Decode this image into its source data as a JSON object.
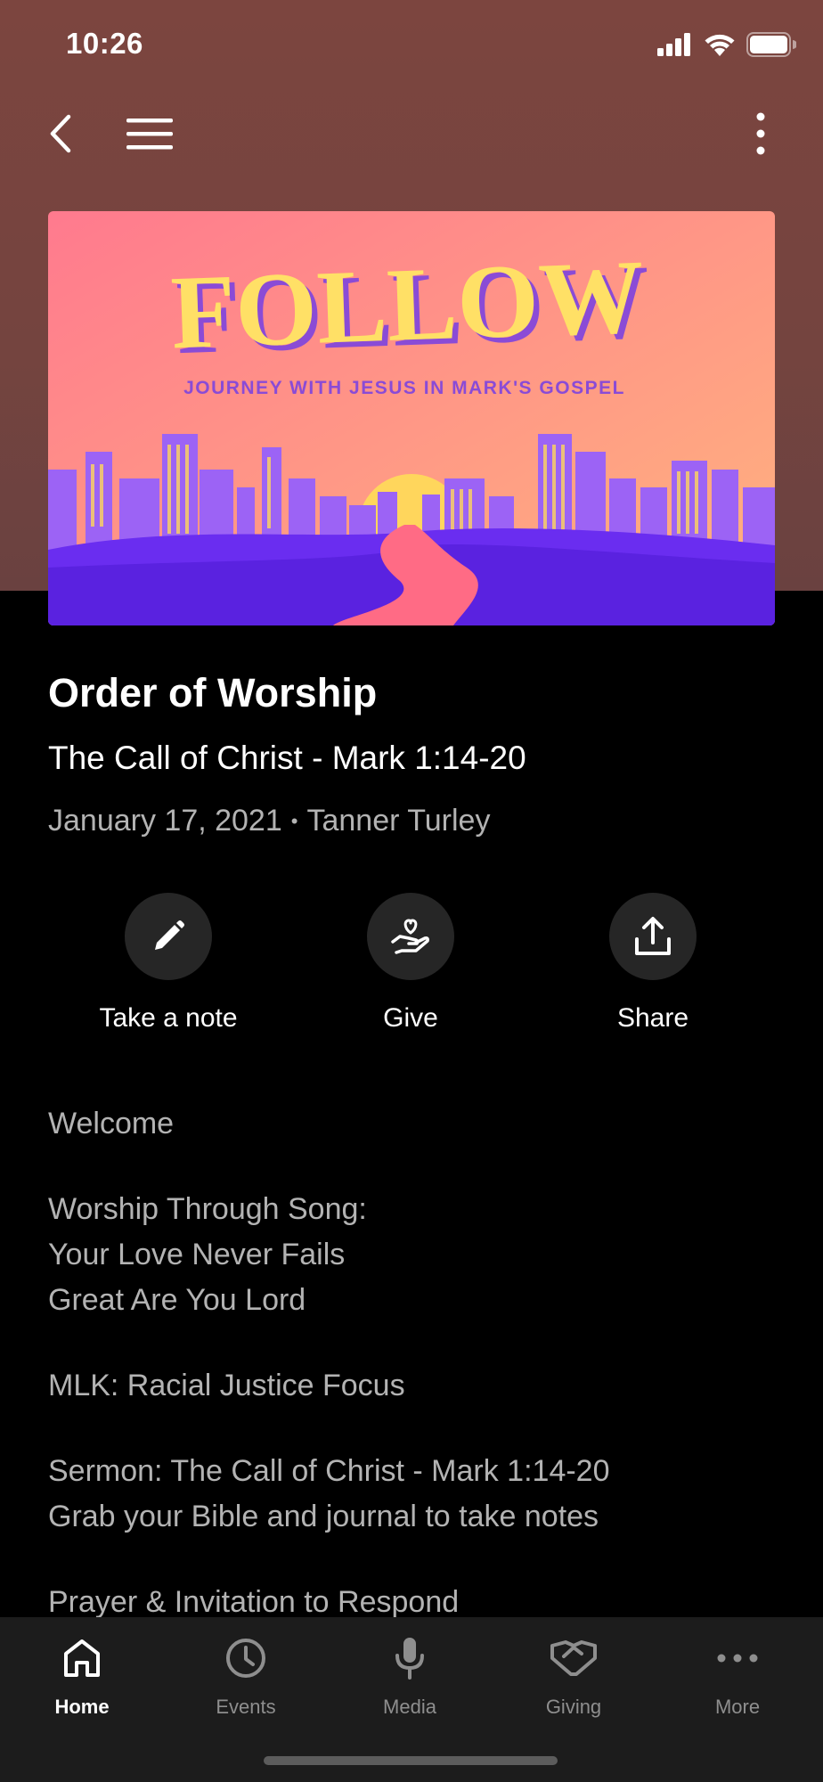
{
  "status": {
    "time": "10:26"
  },
  "nav": {
    "back_icon": "chevron-left-icon",
    "menu_icon": "hamburger-icon",
    "more_icon": "vertical-ellipsis-icon"
  },
  "banner": {
    "headline": "FOLLOW",
    "tagline": "JOURNEY WITH JESUS IN MARK'S GOSPEL",
    "colors": {
      "sky_top": "#ff7a8a",
      "sky_bottom": "#ffb27a",
      "headline": "#ffe066",
      "city": "#9b5cf6",
      "ground": "#6a2bf0",
      "road": "#ff6b81"
    }
  },
  "header": {
    "title": "Order of Worship",
    "subtitle": "The Call of Christ - Mark 1:14-20",
    "date": "January 17, 2021",
    "separator": "•",
    "speaker": "Tanner Turley"
  },
  "actions": [
    {
      "label": "Take a note",
      "icon": "pencil-icon"
    },
    {
      "label": "Give",
      "icon": "hand-heart-icon"
    },
    {
      "label": "Share",
      "icon": "share-icon"
    }
  ],
  "content": {
    "welcome": "Welcome",
    "worship_heading": "Worship Through Song:",
    "song_1": "Your Love Never Fails",
    "song_2": "Great Are You Lord",
    "mlk": "MLK: Racial Justice Focus",
    "sermon": "Sermon: The Call of Christ - Mark 1:14-20",
    "sermon_note": "Grab your Bible and journal to take notes",
    "prayer": "Prayer & Invitation to Respond"
  },
  "tabs": [
    {
      "label": "Home",
      "icon": "home-icon",
      "active": true
    },
    {
      "label": "Events",
      "icon": "clock-icon",
      "active": false
    },
    {
      "label": "Media",
      "icon": "microphone-icon",
      "active": false
    },
    {
      "label": "Giving",
      "icon": "handshake-icon",
      "active": false
    },
    {
      "label": "More",
      "icon": "horizontal-ellipsis-icon",
      "active": false
    }
  ],
  "theme": {
    "background": "#000000",
    "hero": "#7c453f",
    "tabbar": "#1c1c1c",
    "muted_text": "#b3b3b3",
    "inactive_tab": "#8e8e8e"
  }
}
